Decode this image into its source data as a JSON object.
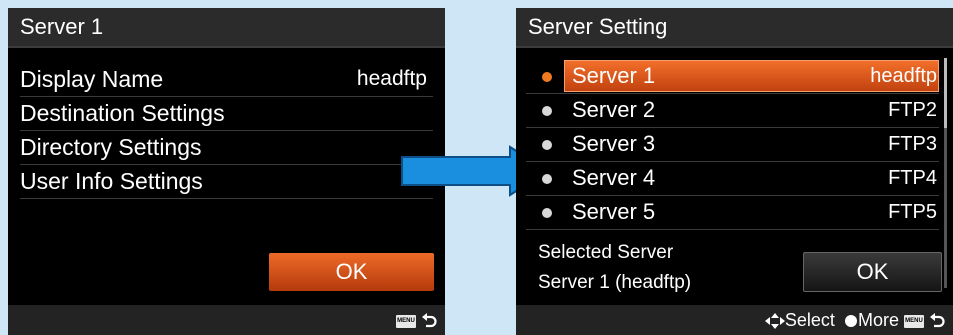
{
  "left_screen": {
    "title": "Server 1",
    "items": [
      {
        "label": "Display Name",
        "value": "headftp"
      },
      {
        "label": "Destination Settings",
        "value": ""
      },
      {
        "label": "Directory Settings",
        "value": ""
      },
      {
        "label": "User Info Settings",
        "value": ""
      }
    ],
    "ok_label": "OK"
  },
  "right_screen": {
    "title": "Server Setting",
    "servers": [
      {
        "name": "Server 1",
        "value": "headftp",
        "selected": true
      },
      {
        "name": "Server 2",
        "value": "FTP2",
        "selected": false
      },
      {
        "name": "Server 3",
        "value": "FTP3",
        "selected": false
      },
      {
        "name": "Server 4",
        "value": "FTP4",
        "selected": false
      },
      {
        "name": "Server 5",
        "value": "FTP5",
        "selected": false
      }
    ],
    "selected_label": "Selected Server",
    "selected_value": "Server 1 (headftp)",
    "ok_label": "OK",
    "footer": {
      "select_label": "Select",
      "more_label": "More",
      "menu_icon_text": "MENU"
    }
  },
  "colors": {
    "accent": "#e8561a",
    "background": "#cfe6f7",
    "arrow": "#1a8fe0"
  },
  "icons": [
    "menu-button-icon",
    "back-arrow-icon",
    "select-arrows-icon",
    "circle-button-icon",
    "right-arrow-icon"
  ]
}
